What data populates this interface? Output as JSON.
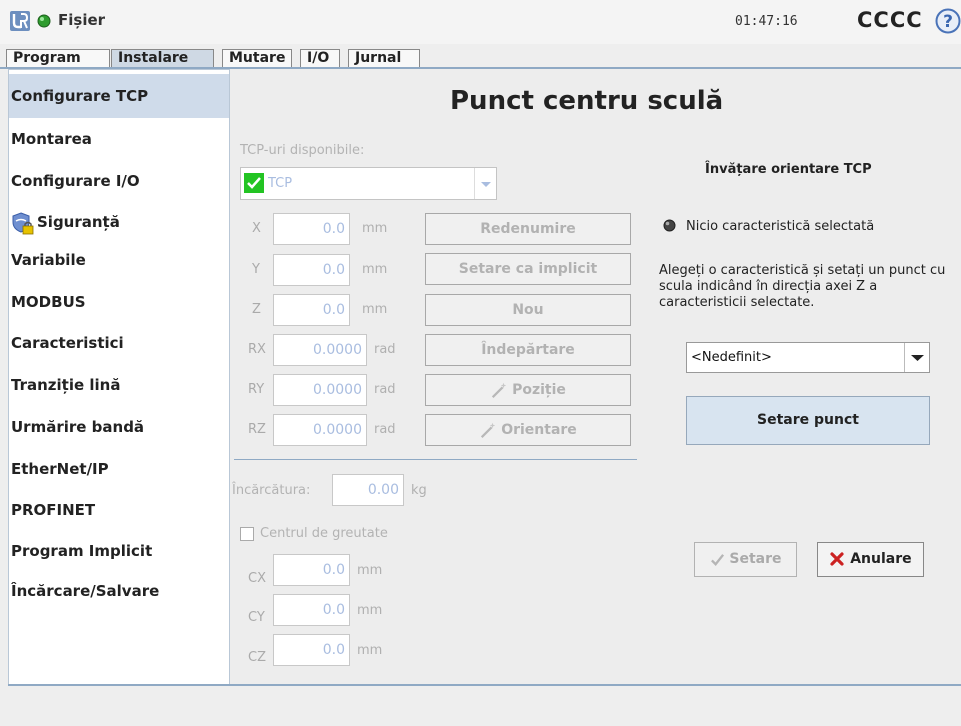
{
  "header": {
    "menu_label": "Fișier",
    "time": "01:47:16",
    "robot_name": "CCCC"
  },
  "tabs": [
    {
      "label": "Program"
    },
    {
      "label": "Instalare",
      "active": true
    },
    {
      "label": "Mutare"
    },
    {
      "label": "I/O"
    },
    {
      "label": "Jurnal"
    }
  ],
  "sidebar": {
    "items": [
      {
        "label": "Configurare TCP",
        "selected": true
      },
      {
        "label": "Montarea"
      },
      {
        "label": "Configurare I/O"
      },
      {
        "label": "Siguranță",
        "icon": "shield-lock-icon"
      },
      {
        "label": "Variabile"
      },
      {
        "label": "MODBUS"
      },
      {
        "label": "Caracteristici"
      },
      {
        "label": "Tranziție lină"
      },
      {
        "label": "Urmărire bandă"
      },
      {
        "label": "EtherNet/IP"
      },
      {
        "label": "PROFINET"
      },
      {
        "label": "Program Implicit"
      },
      {
        "label": "Încărcare/Salvare"
      }
    ]
  },
  "main": {
    "title": "Punct centru sculă",
    "tcp_list_label": "TCP-uri disponibile:",
    "tcp_selected": "TCP",
    "fields": [
      {
        "name": "X",
        "value": "0.0",
        "unit": "mm"
      },
      {
        "name": "Y",
        "value": "0.0",
        "unit": "mm"
      },
      {
        "name": "Z",
        "value": "0.0",
        "unit": "mm"
      },
      {
        "name": "RX",
        "value": "0.0000",
        "unit": "rad"
      },
      {
        "name": "RY",
        "value": "0.0000",
        "unit": "rad"
      },
      {
        "name": "RZ",
        "value": "0.0000",
        "unit": "rad"
      }
    ],
    "buttons": {
      "rename": "Redenumire",
      "set_default": "Setare ca implicit",
      "new": "Nou",
      "remove": "Îndepărtare",
      "position": "Poziție",
      "orientation": "Orientare"
    },
    "payload_label": "Încărcătura:",
    "payload_value": "0.00",
    "payload_unit": "kg",
    "cog_label": "Centrul de greutate",
    "cog_checked": false,
    "cog_fields": [
      {
        "name": "CX",
        "value": "0.0",
        "unit": "mm"
      },
      {
        "name": "CY",
        "value": "0.0",
        "unit": "mm"
      },
      {
        "name": "CZ",
        "value": "0.0",
        "unit": "mm"
      }
    ]
  },
  "teach": {
    "heading": "Învățare orientare TCP",
    "status": "Nicio caracteristică selectată",
    "instructions": "Alegeți o caracteristică și setați un punct cu scula indicând în direcția axei Z a caracteristicii selectate.",
    "feature_select": "<Nedefinit>",
    "set_point": "Setare punct",
    "set": "Setare",
    "cancel": "Anulare"
  },
  "colors": {
    "accent": "#8fa9c4",
    "selected_bg": "#cfdbea",
    "disabled_text": "#b2b2b2",
    "tcp_check": "#23c423",
    "cancel_x": "#cc2222"
  }
}
